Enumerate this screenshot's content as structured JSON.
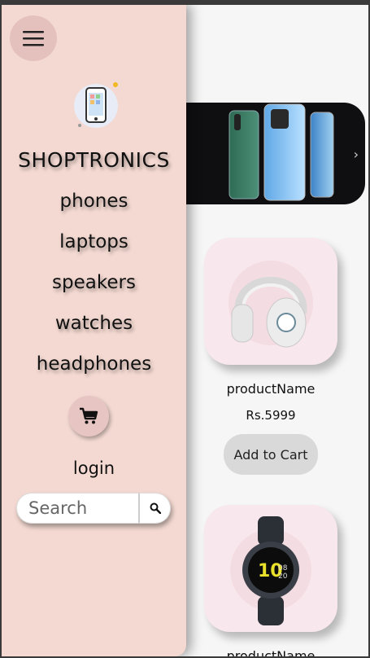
{
  "brand": {
    "name": "SHOPTRONICS"
  },
  "nav": {
    "items": [
      {
        "label": "phones"
      },
      {
        "label": "laptops"
      },
      {
        "label": "speakers"
      },
      {
        "label": "watches"
      },
      {
        "label": "headphones"
      }
    ],
    "login_label": "login",
    "search_placeholder": "Search"
  },
  "icons": {
    "menu": "hamburger-menu-icon",
    "logo": "phone-logo-icon",
    "cart": "cart-icon",
    "search": "search-icon",
    "carousel_next": "chevron-right-icon"
  },
  "colors": {
    "sidebar_bg": "#f3d9d1",
    "card_bg": "#f8e7ec",
    "button_bg": "#d9d9d9"
  },
  "products": [
    {
      "name": "productName",
      "price": "Rs.5999",
      "button": "Add to Cart",
      "image": "headphones"
    },
    {
      "name": "productName",
      "image": "smartwatch"
    }
  ]
}
